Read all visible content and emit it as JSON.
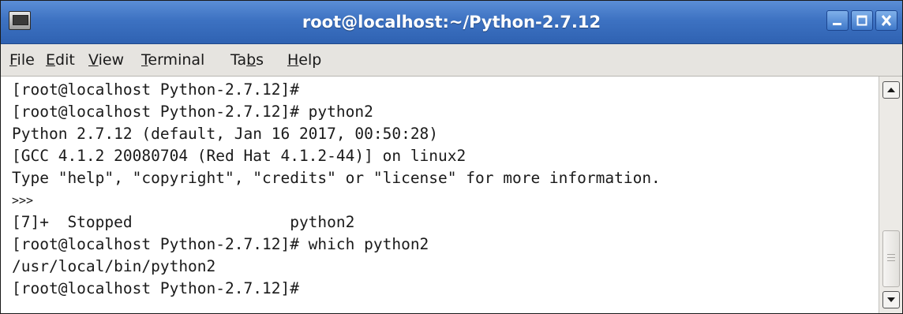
{
  "window": {
    "title": "root@localhost:~/Python-2.7.12"
  },
  "menu": [
    {
      "pre": "",
      "key": "F",
      "post": "ile"
    },
    {
      "pre": "",
      "key": "E",
      "post": "dit"
    },
    {
      "pre": "",
      "key": "V",
      "post": "iew"
    },
    {
      "pre": "",
      "key": "T",
      "post": "erminal"
    },
    {
      "pre": "Ta",
      "key": "b",
      "post": "s"
    },
    {
      "pre": "",
      "key": "H",
      "post": "elp"
    }
  ],
  "terminal": {
    "lines": [
      "[root@localhost Python-2.7.12]#",
      "[root@localhost Python-2.7.12]# python2",
      "Python 2.7.12 (default, Jan 16 2017, 00:50:28)",
      "[GCC 4.1.2 20080704 (Red Hat 4.1.2-44)] on linux2",
      "Type \"help\", \"copyright\", \"credits\" or \"license\" for more information.",
      ">>>",
      "[7]+  Stopped                 python2",
      "[root@localhost Python-2.7.12]# which python2",
      "/usr/local/bin/python2",
      "[root@localhost Python-2.7.12]#"
    ]
  },
  "icons": {
    "app": "terminal-app-icon",
    "minimize": "minimize-icon",
    "maximize": "maximize-icon",
    "close": "close-icon",
    "scroll_up": "scroll-up-arrow-icon",
    "scroll_down": "scroll-down-arrow-icon"
  },
  "colors": {
    "titlebar": "#3d72c2",
    "menubar": "#e6e4e0",
    "terminal_bg": "#ffffff",
    "terminal_fg": "#1a1a1a"
  }
}
